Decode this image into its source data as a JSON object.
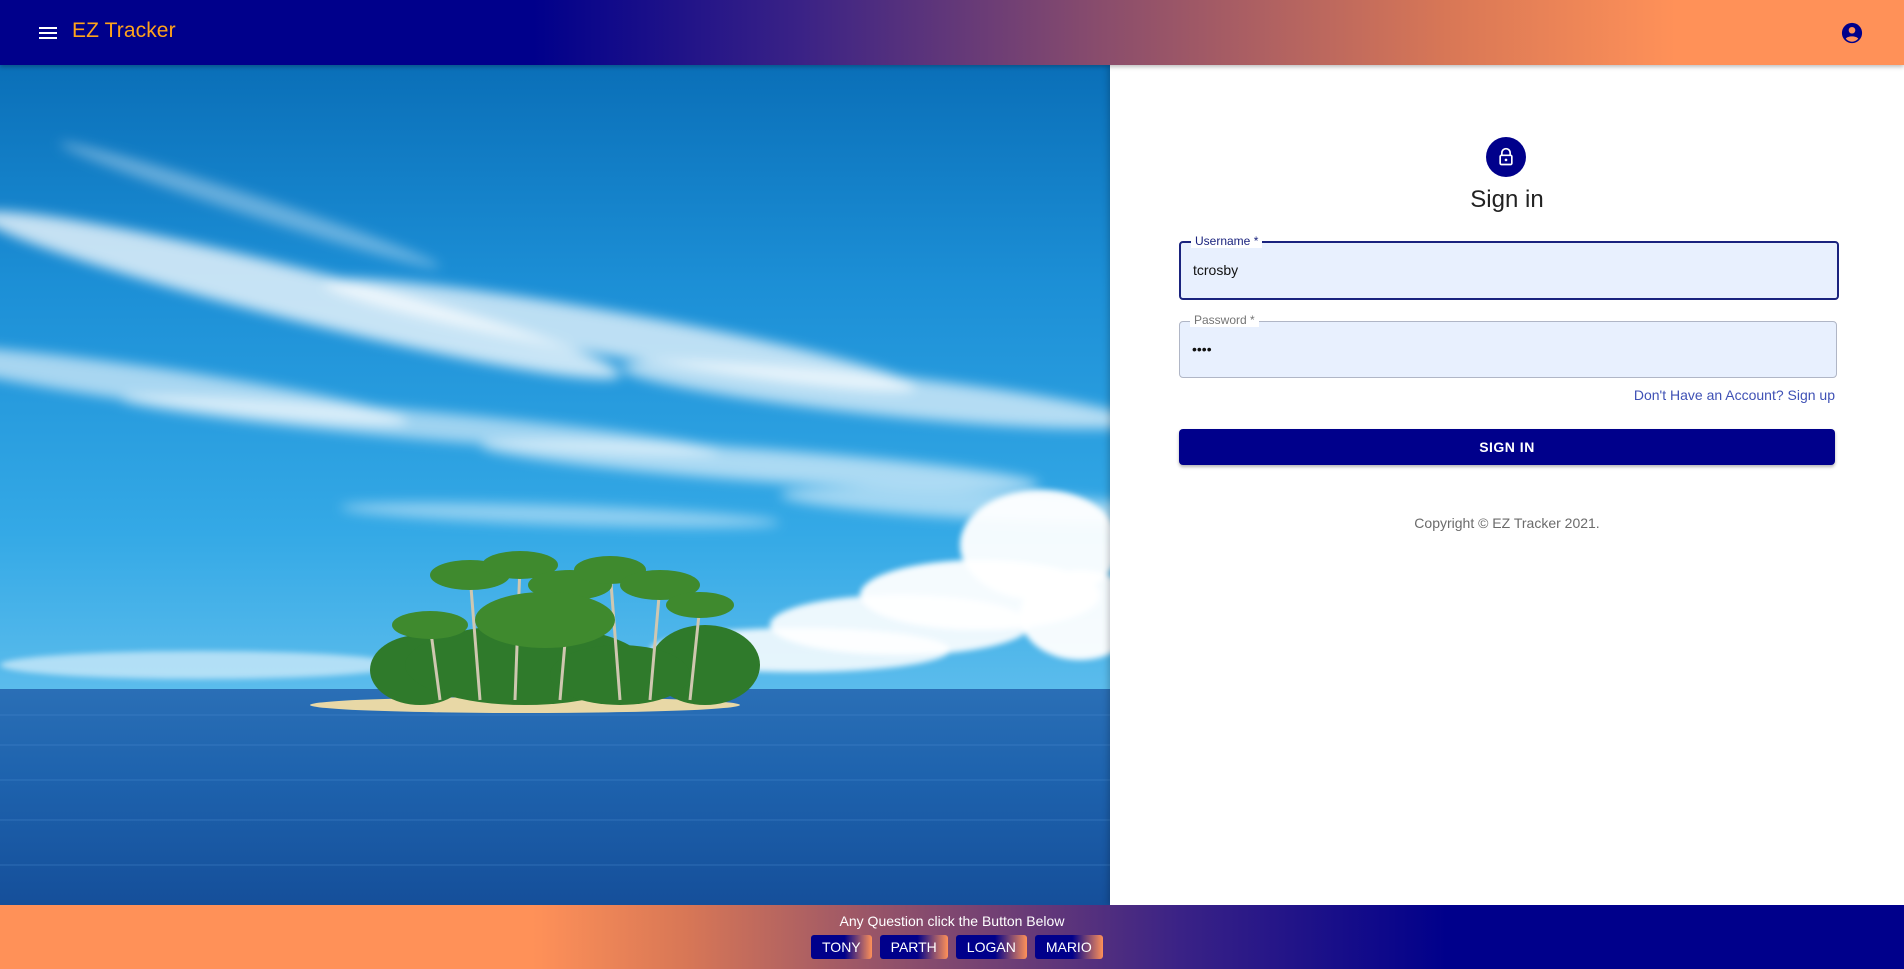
{
  "header": {
    "title": "EZ Tracker",
    "menu_icon": "hamburger-menu-icon",
    "account_icon": "account-circle-icon",
    "title_color": "#ffa31a"
  },
  "signin": {
    "lock_icon": "lock-icon",
    "title": "Sign in",
    "username": {
      "label": "Username *",
      "value": "tcrosby"
    },
    "password": {
      "label": "Password *",
      "value": "••••"
    },
    "signup_link": "Don't Have an Account? Sign up",
    "submit_label": "SIGN IN",
    "copyright": "Copyright © EZ Tracker 2021."
  },
  "footer": {
    "prompt": "Any Question click the Button Below",
    "contacts": [
      "TONY",
      "PARTH",
      "LOGAN",
      "MARIO"
    ]
  },
  "colors": {
    "primary": "#00008b",
    "accent": "#ff9158",
    "link": "#3f51b5",
    "input_background": "#e8f0fe"
  }
}
